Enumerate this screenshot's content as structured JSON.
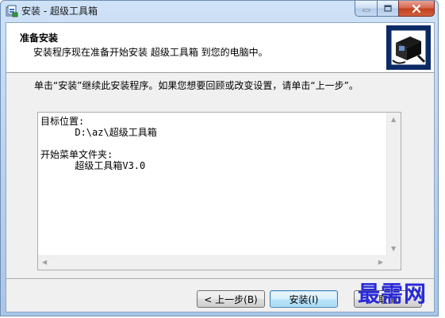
{
  "window": {
    "title": "安装 - 超级工具箱"
  },
  "header": {
    "title": "准备安装",
    "subtitle": "安装程序现在准备开始安装 超级工具箱 到您的电脑中。"
  },
  "instruction": "单击“安装”继续此安装程序。如果您想要回顾或改变设置，请单击“上一步”。",
  "memo": {
    "dest_label": "目标位置:",
    "dest_value": "      D:\\az\\超级工具箱",
    "menu_label": "开始菜单文件夹:",
    "menu_value": "      超级工具箱V3.0"
  },
  "buttons": {
    "back": "< 上一步(B)",
    "install": "安装(I)",
    "cancel": "取消"
  },
  "watermark": "最需网",
  "icons": {
    "app": "installer-icon",
    "logo": "computer-box-icon"
  },
  "colors": {
    "accent": "#2a2ad8",
    "close": "#c3401f"
  }
}
